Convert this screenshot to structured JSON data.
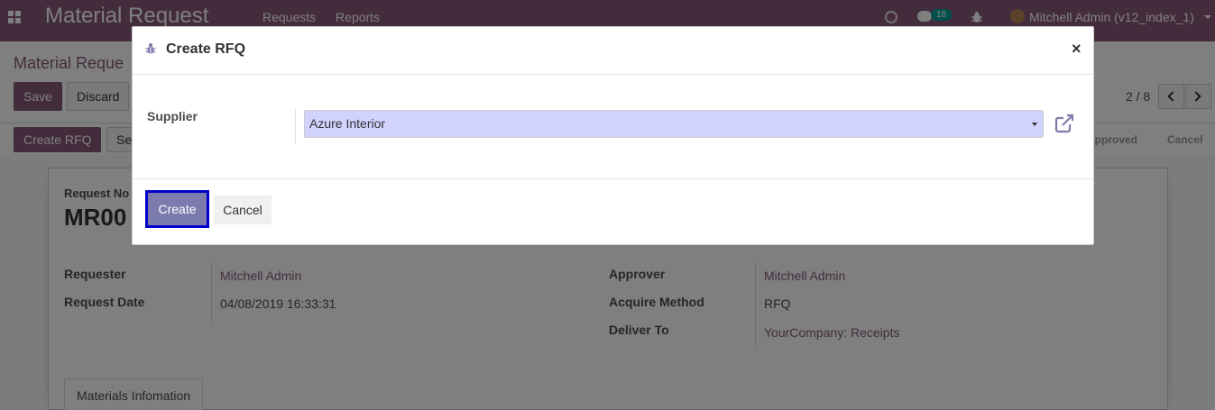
{
  "navbar": {
    "app_title": "Material Request",
    "menu": [
      "Requests",
      "Reports"
    ],
    "chat_count": "18",
    "user": "Mitchell Admin (v12_index_1)"
  },
  "control_panel": {
    "breadcrumb": "Material Reque",
    "save_label": "Save",
    "discard_label": "Discard",
    "pager": "2 / 8",
    "create_rfq_label": "Create RFQ",
    "set_label": "Se",
    "status_items": [
      "Approved",
      "Cancel"
    ]
  },
  "form": {
    "request_no_label": "Request No",
    "request_no_value": "MR00",
    "requester_label": "Requester",
    "requester_value": "Mitchell Admin",
    "request_date_label": "Request Date",
    "request_date_value": "04/08/2019 16:33:31",
    "approver_label": "Approver",
    "approver_value": "Mitchell Admin",
    "acquire_method_label": "Acquire Method",
    "acquire_method_value": "RFQ",
    "deliver_to_label": "Deliver To",
    "deliver_to_value": "YourCompany: Receipts",
    "tab_label": "Materials Infomation"
  },
  "modal": {
    "title": "Create RFQ",
    "close_glyph": "×",
    "supplier_label": "Supplier",
    "supplier_value": "Azure Interior",
    "create_label": "Create",
    "cancel_label": "Cancel"
  },
  "colors": {
    "brand": "#875a7b",
    "create_button": "#7c7bad",
    "focus_outline": "#0000cc",
    "supplier_input_bg": "#d2d2ff"
  }
}
